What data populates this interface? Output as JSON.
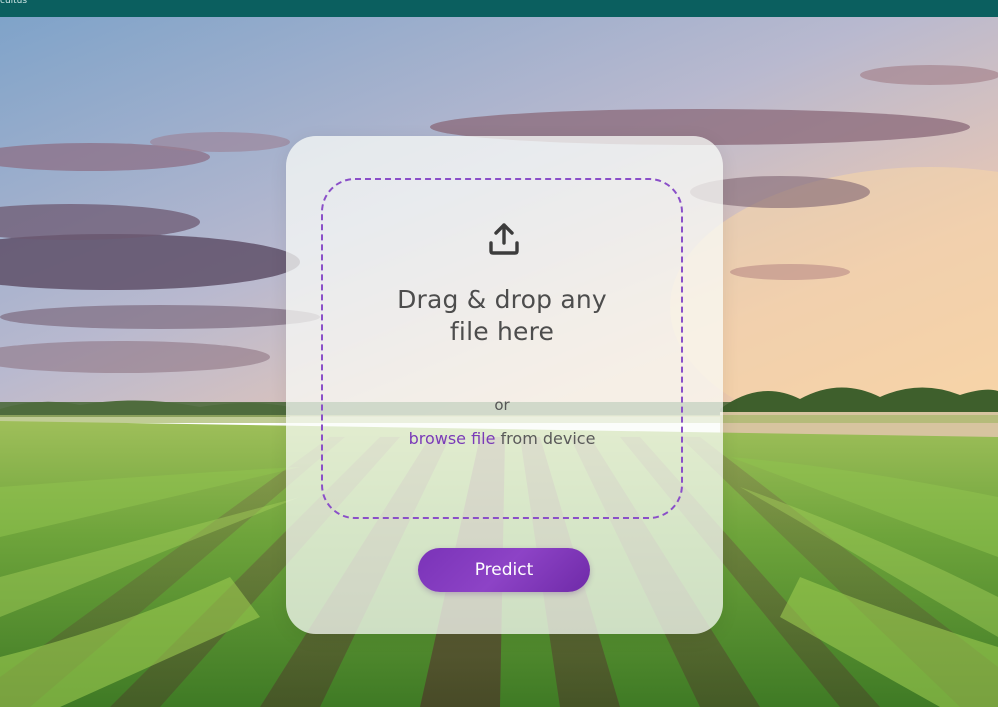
{
  "topbar": {
    "text": "cultus",
    "color": "#0b5f5f"
  },
  "upload": {
    "icon": "upload-icon",
    "headline_line1": "Drag & drop any",
    "headline_line2": "file here",
    "or": "or",
    "browse_link": "browse file",
    "browse_suffix": " from device",
    "accent_color": "#7a3bb8"
  },
  "actions": {
    "predict_label": "Predict"
  }
}
